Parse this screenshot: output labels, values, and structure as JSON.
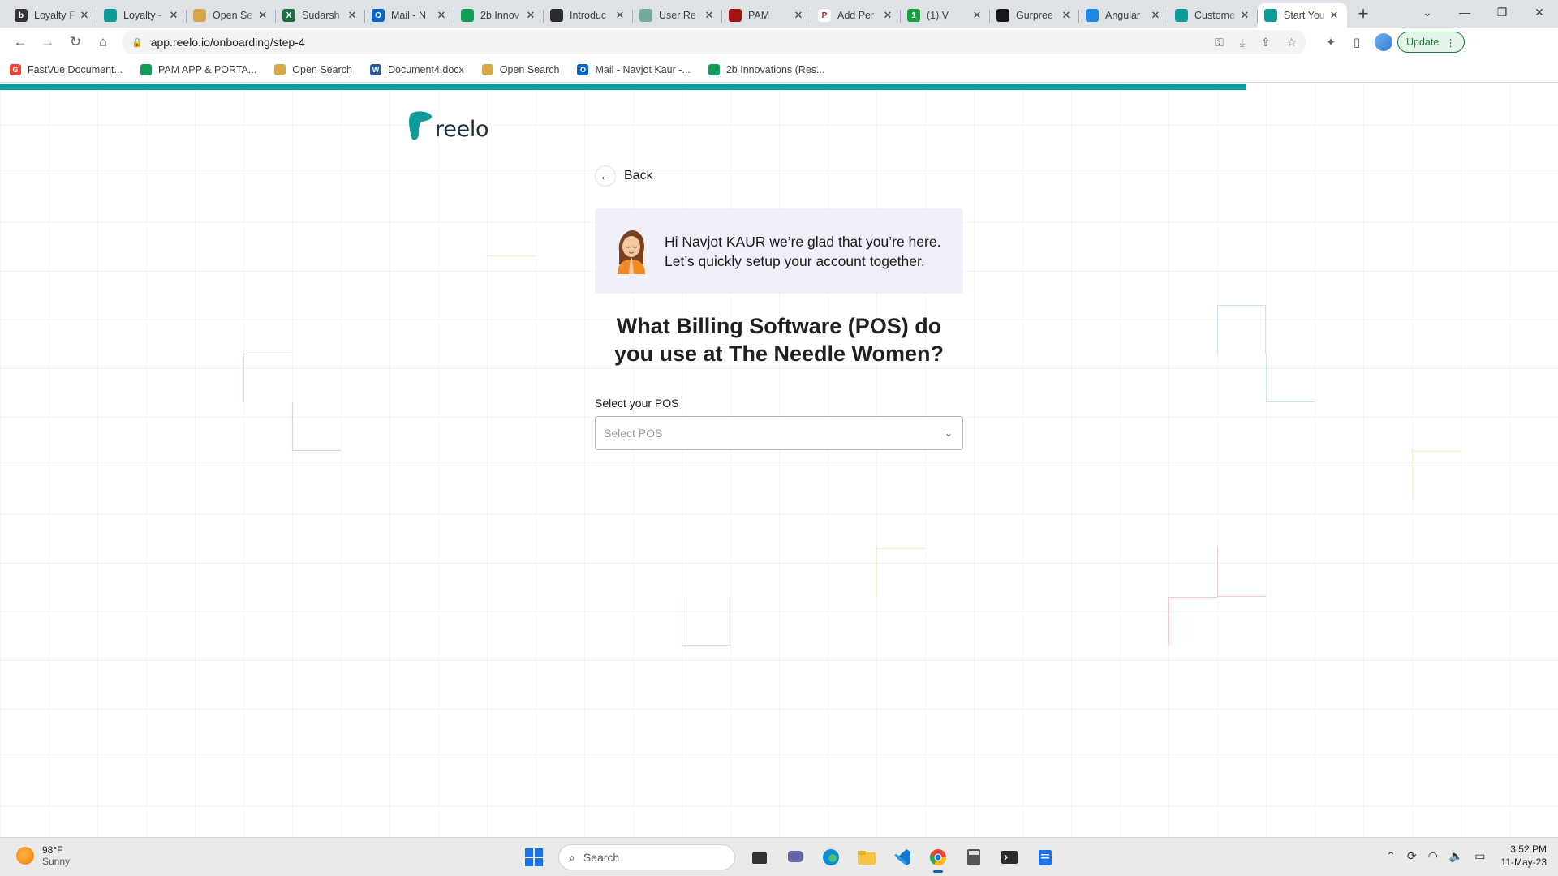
{
  "tabs": [
    {
      "title": "Loyalty F",
      "fav_color": "#333333",
      "fav_glyph": "b",
      "fav_text": "#ffffff"
    },
    {
      "title": "Loyalty -",
      "fav_color": "#119a9a",
      "fav_glyph": "",
      "fav_text": "#ffffff"
    },
    {
      "title": "Open Se",
      "fav_color": "#d4a84b",
      "fav_glyph": "",
      "fav_text": "#ffffff"
    },
    {
      "title": "Sudarsh",
      "fav_color": "#1d6f42",
      "fav_glyph": "X",
      "fav_text": "#ffffff"
    },
    {
      "title": "Mail - N",
      "fav_color": "#0a64c8",
      "fav_glyph": "O",
      "fav_text": "#ffffff"
    },
    {
      "title": "2b Innov",
      "fav_color": "#0f9d58",
      "fav_glyph": "",
      "fav_text": "#ffffff"
    },
    {
      "title": "Introduc",
      "fav_color": "#2b2b2b",
      "fav_glyph": "",
      "fav_text": "#ffffff"
    },
    {
      "title": "User Re",
      "fav_color": "#74aa9c",
      "fav_glyph": "",
      "fav_text": "#ffffff"
    },
    {
      "title": "PAM",
      "fav_color": "#a31515",
      "fav_glyph": "",
      "fav_text": "#ffffff"
    },
    {
      "title": "Add Per",
      "fav_color": "#ffffff",
      "fav_glyph": "P",
      "fav_text": "#b71c1c"
    },
    {
      "title": "(1) V",
      "fav_color": "#14a33c",
      "fav_glyph": "1",
      "fav_text": "#ffffff"
    },
    {
      "title": "Gurpree",
      "fav_color": "#181717",
      "fav_glyph": "",
      "fav_text": "#ffffff"
    },
    {
      "title": "Angular",
      "fav_color": "#1e88e5",
      "fav_glyph": "",
      "fav_text": "#ffffff"
    },
    {
      "title": "Custome",
      "fav_color": "#119a9a",
      "fav_glyph": "",
      "fav_text": "#ffffff"
    },
    {
      "title": "Start You",
      "fav_color": "#119a9a",
      "fav_glyph": "",
      "fav_text": "#ffffff"
    }
  ],
  "browser": {
    "url": "app.reelo.io/onboarding/step-4",
    "update_label": "Update"
  },
  "bookmarks": [
    {
      "label": "FastVue Document...",
      "color": "#ea4335",
      "glyph": "G"
    },
    {
      "label": "PAM APP & PORTA...",
      "color": "#0f9d58",
      "glyph": ""
    },
    {
      "label": "Open Search",
      "color": "#d4a84b",
      "glyph": ""
    },
    {
      "label": "Document4.docx",
      "color": "#2b579a",
      "glyph": "W"
    },
    {
      "label": "Open Search",
      "color": "#d4a84b",
      "glyph": ""
    },
    {
      "label": "Mail - Navjot Kaur -...",
      "color": "#0a64c8",
      "glyph": "O"
    },
    {
      "label": "2b Innovations (Res...",
      "color": "#0f9d58",
      "glyph": ""
    }
  ],
  "page": {
    "logo_text": "reelo",
    "back_label": "Back",
    "greeting": "Hi Navjot KAUR we’re glad that you’re here. Let’s quickly setup your account together.",
    "question": "What Billing Software (POS) do you use at The Needle Women?",
    "field_label": "Select your POS",
    "select_placeholder": "Select POS",
    "progress_fraction": 0.8,
    "accent_color": "#119a9a"
  },
  "taskbar": {
    "weather_temp": "98°F",
    "weather_desc": "Sunny",
    "search_placeholder": "Search",
    "time": "3:52 PM",
    "date": "11-May-23"
  }
}
